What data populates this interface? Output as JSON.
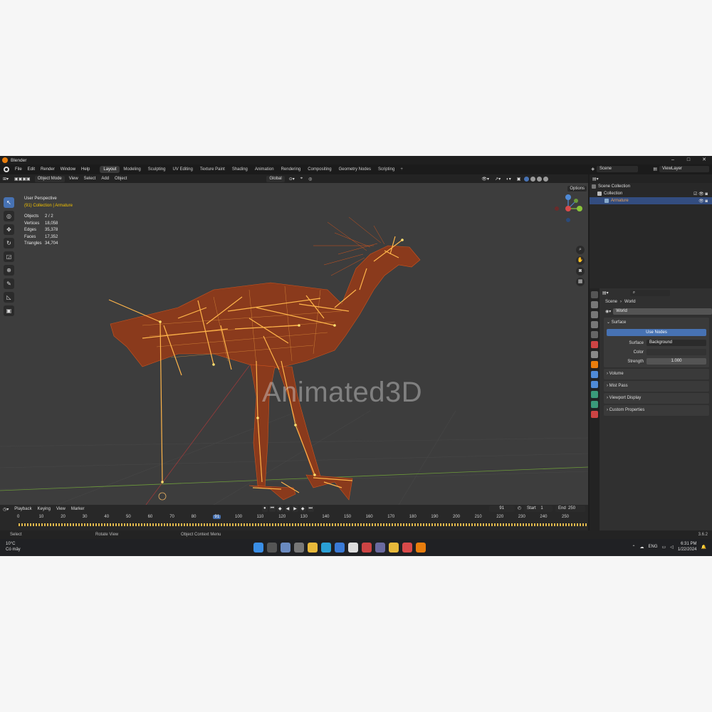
{
  "window": {
    "title": "Blender"
  },
  "menus": [
    "File",
    "Edit",
    "Render",
    "Window",
    "Help"
  ],
  "workspaces": [
    "Layout",
    "Modeling",
    "Sculpting",
    "UV Editing",
    "Texture Paint",
    "Shading",
    "Animation",
    "Rendering",
    "Compositing",
    "Geometry Nodes",
    "Scripting"
  ],
  "active_workspace": "Layout",
  "scene": {
    "name": "Scene",
    "view_layer": "ViewLayer"
  },
  "viewport_header": {
    "mode": "Object Mode",
    "menus": [
      "View",
      "Select",
      "Add",
      "Object"
    ],
    "orientation": "Global",
    "options_label": "Options"
  },
  "viewport": {
    "perspective": "User Perspective",
    "collection": "(91) Collection | Armature",
    "stats": [
      {
        "k": "Objects",
        "v": "2 / 2"
      },
      {
        "k": "Vertices",
        "v": "18,058"
      },
      {
        "k": "Edges",
        "v": "35,378"
      },
      {
        "k": "Faces",
        "v": "17,352"
      },
      {
        "k": "Triangles",
        "v": "34,704"
      }
    ],
    "watermark": "Animated3D"
  },
  "outliner": {
    "root": "Scene Collection",
    "collection": "Collection",
    "object": "Armature"
  },
  "properties": {
    "breadcrumb_scene": "Scene",
    "breadcrumb_world": "World",
    "world_name": "World",
    "panel_surface": "Surface",
    "use_nodes": "Use Nodes",
    "surface_label": "Surface",
    "surface_value": "Background",
    "color_label": "Color",
    "strength_label": "Strength",
    "strength_value": "1.000",
    "panels": [
      "Volume",
      "Mist Pass",
      "Viewport Display",
      "Custom Properties"
    ]
  },
  "timeline": {
    "menus": [
      "Playback",
      "Keying",
      "View",
      "Marker"
    ],
    "current_frame": "91",
    "start_label": "Start",
    "start": "1",
    "end_label": "End",
    "end": "250",
    "ticks": [
      "0",
      "10",
      "20",
      "30",
      "40",
      "50",
      "60",
      "70",
      "80",
      "91",
      "100",
      "110",
      "120",
      "130",
      "140",
      "150",
      "160",
      "170",
      "180",
      "190",
      "200",
      "210",
      "220",
      "230",
      "240",
      "250"
    ]
  },
  "statusbar": {
    "select": "Select",
    "rotate": "Rotate View",
    "context": "Object Context Menu",
    "version": "3.6.2"
  },
  "taskbar": {
    "temp": "10°C",
    "weather": "Có mây",
    "lang": "ENG",
    "time": "6:31 PM",
    "date": "1/22/2024"
  },
  "colors": {
    "accent": "#4772b3",
    "selection": "#e87d0d",
    "bone": "#ffb54a",
    "collection_text": "#f0c000"
  }
}
